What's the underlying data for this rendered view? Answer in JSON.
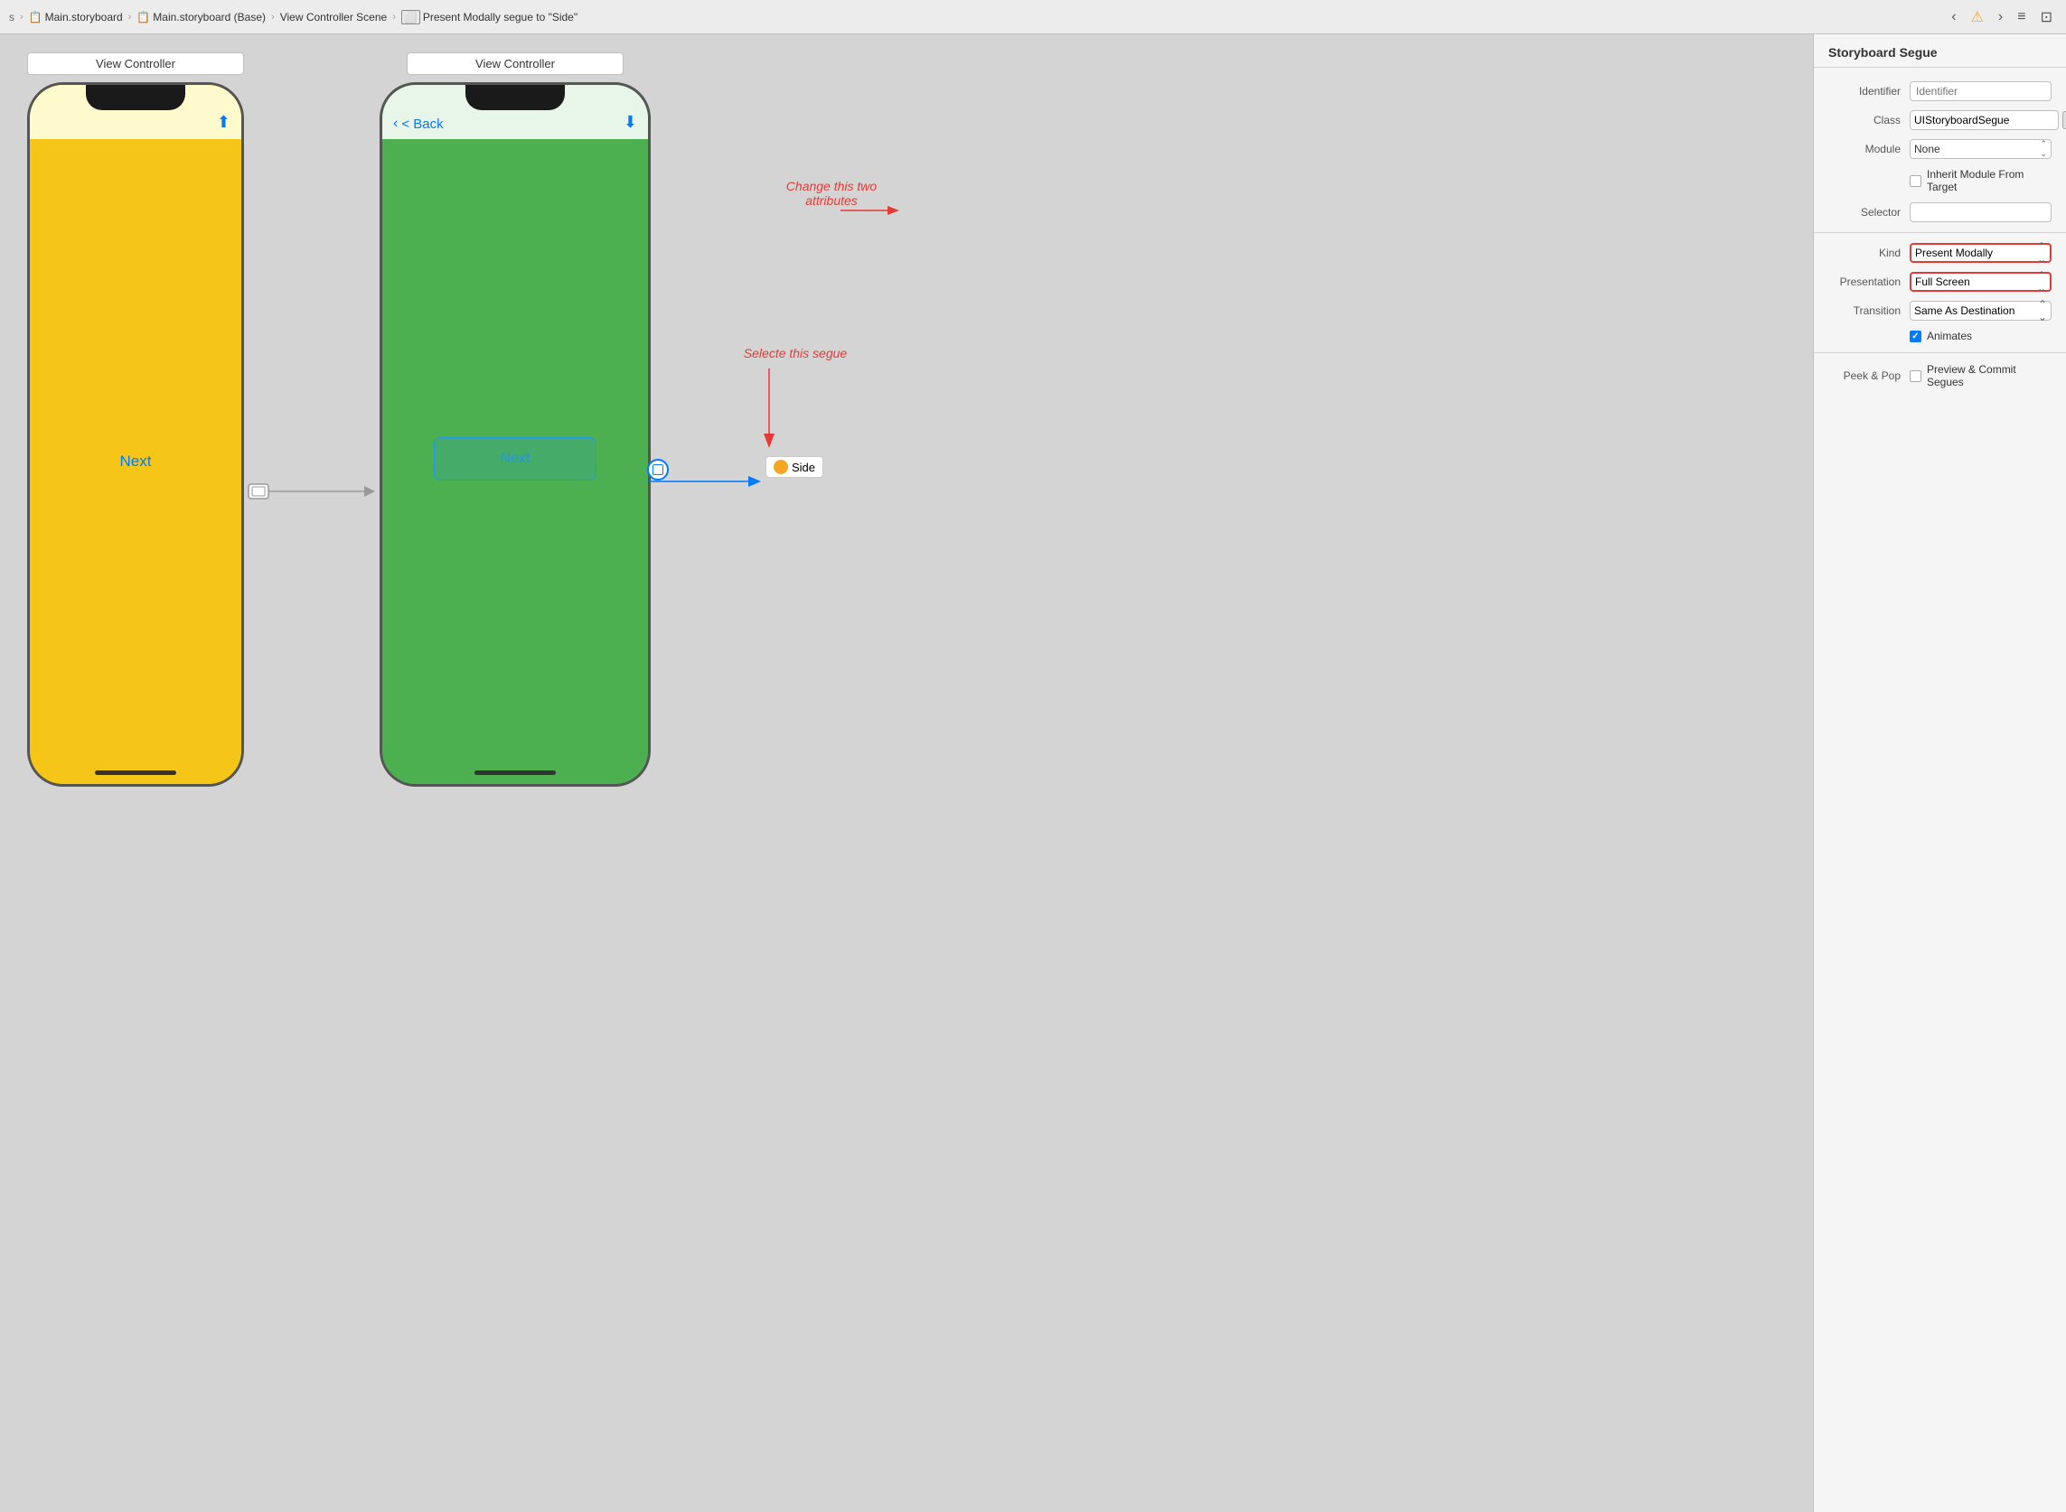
{
  "toolbar": {
    "breadcrumbs": [
      {
        "label": "s"
      },
      {
        "label": "Main.storyboard"
      },
      {
        "label": "Main.storyboard (Base)"
      },
      {
        "label": "View Controller Scene"
      },
      {
        "label": "Present Modally segue to \"Side\""
      }
    ],
    "nav_buttons": [
      "‹",
      "!",
      "›"
    ],
    "toolbar_icons": [
      "≡",
      "⊡"
    ]
  },
  "canvas": {
    "vc1_label": "View Controller",
    "vc2_label": "View Controller",
    "yellow_phone": {
      "next_text": "Next"
    },
    "green_phone": {
      "back_text": "< Back",
      "next_text": "Next"
    },
    "annotation1": {
      "text": "Change this two\nattributes"
    },
    "annotation2": {
      "text": "Selecte this segue"
    },
    "side_label": "Side"
  },
  "right_panel": {
    "title": "Storyboard Segue",
    "fields": {
      "identifier_label": "Identifier",
      "identifier_placeholder": "Identifier",
      "class_label": "Class",
      "class_value": "UIStoryboardSegue",
      "module_label": "Module",
      "module_value": "None",
      "inherit_label": "",
      "inherit_checkbox_label": "Inherit Module From Target",
      "selector_label": "Selector",
      "kind_label": "Kind",
      "kind_value": "Present Modally",
      "presentation_label": "Presentation",
      "presentation_value": "Full Screen",
      "transition_label": "Transition",
      "transition_value": "Same As Destination",
      "animates_label": "Animates",
      "peek_label": "Peek & Pop",
      "preview_label": "Preview & Commit Segues"
    }
  }
}
